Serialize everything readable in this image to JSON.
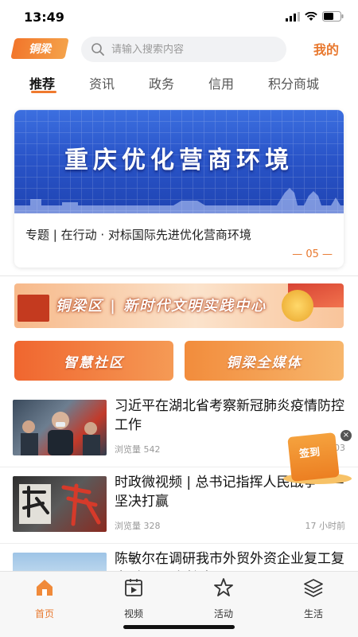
{
  "status_bar": {
    "time": "13:49"
  },
  "header": {
    "logo_text": "铜梁",
    "search_placeholder": "请输入搜索内容",
    "my_label": "我的"
  },
  "tabs": [
    {
      "label": "推荐",
      "active": true
    },
    {
      "label": "资讯",
      "active": false
    },
    {
      "label": "政务",
      "active": false
    },
    {
      "label": "信用",
      "active": false
    },
    {
      "label": "积分商城",
      "active": false
    }
  ],
  "banner": {
    "image_title": "重庆优化营商环境",
    "caption": "专题 | 在行动 · 对标国际先进优化营商环境",
    "page_indicator": "— 05 —"
  },
  "civilization_banner": {
    "text": "铜梁区 | 新时代文明实践中心"
  },
  "feature_buttons": [
    {
      "label": "智慧社区"
    },
    {
      "label": "铜梁全媒体"
    }
  ],
  "news": [
    {
      "title": "习近平在湖北省考察新冠肺炎疫情防控工作",
      "views": "浏览量 542",
      "time": "03"
    },
    {
      "title": "时政微视频 | 总书记指挥人民战争——坚决打赢",
      "views": "浏览量 328",
      "time": "17 小时前"
    },
    {
      "title": "陈敏尔在调研我市外贸外资企业复工复产时强调 在扩大",
      "views": "",
      "time": ""
    }
  ],
  "signin": {
    "label": "签到",
    "close": "×"
  },
  "bottom_nav": [
    {
      "label": "首页",
      "icon": "home-icon",
      "active": true
    },
    {
      "label": "视频",
      "icon": "video-icon",
      "active": false
    },
    {
      "label": "活动",
      "icon": "star-icon",
      "active": false
    },
    {
      "label": "生活",
      "icon": "layers-icon",
      "active": false
    }
  ],
  "colors": {
    "accent": "#e8782e",
    "banner_blue": "#2a55c9"
  }
}
